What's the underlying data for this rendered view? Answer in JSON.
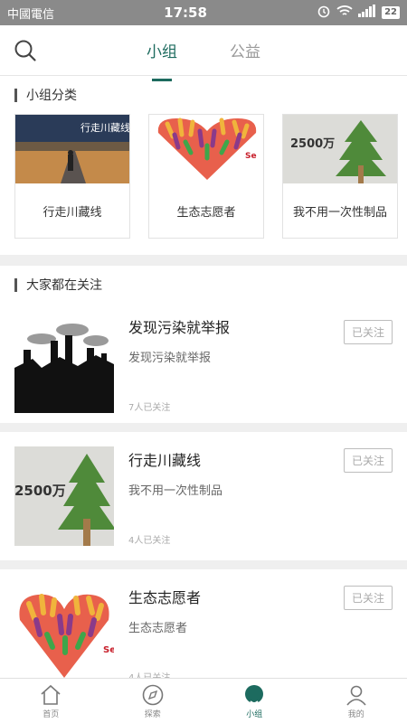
{
  "status": {
    "carrier": "中國電信",
    "time": "17:58",
    "battery": "22"
  },
  "header": {
    "tabs": [
      {
        "label": "小组"
      },
      {
        "label": "公益"
      }
    ]
  },
  "categories": {
    "title": "小组分类",
    "items": [
      {
        "label": "行走川藏线",
        "image_caption": "行走川藏线"
      },
      {
        "label": "生态志愿者"
      },
      {
        "label": "我不用一次性制品",
        "image_caption": "2500万"
      }
    ]
  },
  "feed": {
    "title": "大家都在关注",
    "items": [
      {
        "title": "发现污染就举报",
        "desc": "发现污染就举报",
        "count": "7人已关注",
        "follow_label": "已关注"
      },
      {
        "title": "行走川藏线",
        "desc": "我不用一次性制品",
        "count": "4人已关注",
        "follow_label": "已关注",
        "image_caption": "2500万"
      },
      {
        "title": "生态志愿者",
        "desc": "生态志愿者",
        "count": "4人已关注",
        "follow_label": "已关注"
      }
    ]
  },
  "tabbar": {
    "items": [
      {
        "label": "首页",
        "icon": "home-icon"
      },
      {
        "label": "探索",
        "icon": "compass-icon"
      },
      {
        "label": "小组",
        "icon": "group-icon"
      },
      {
        "label": "我的",
        "icon": "person-icon"
      }
    ]
  },
  "colors": {
    "accent": "#1d6b5f",
    "statusbar": "#8a8a8a"
  }
}
